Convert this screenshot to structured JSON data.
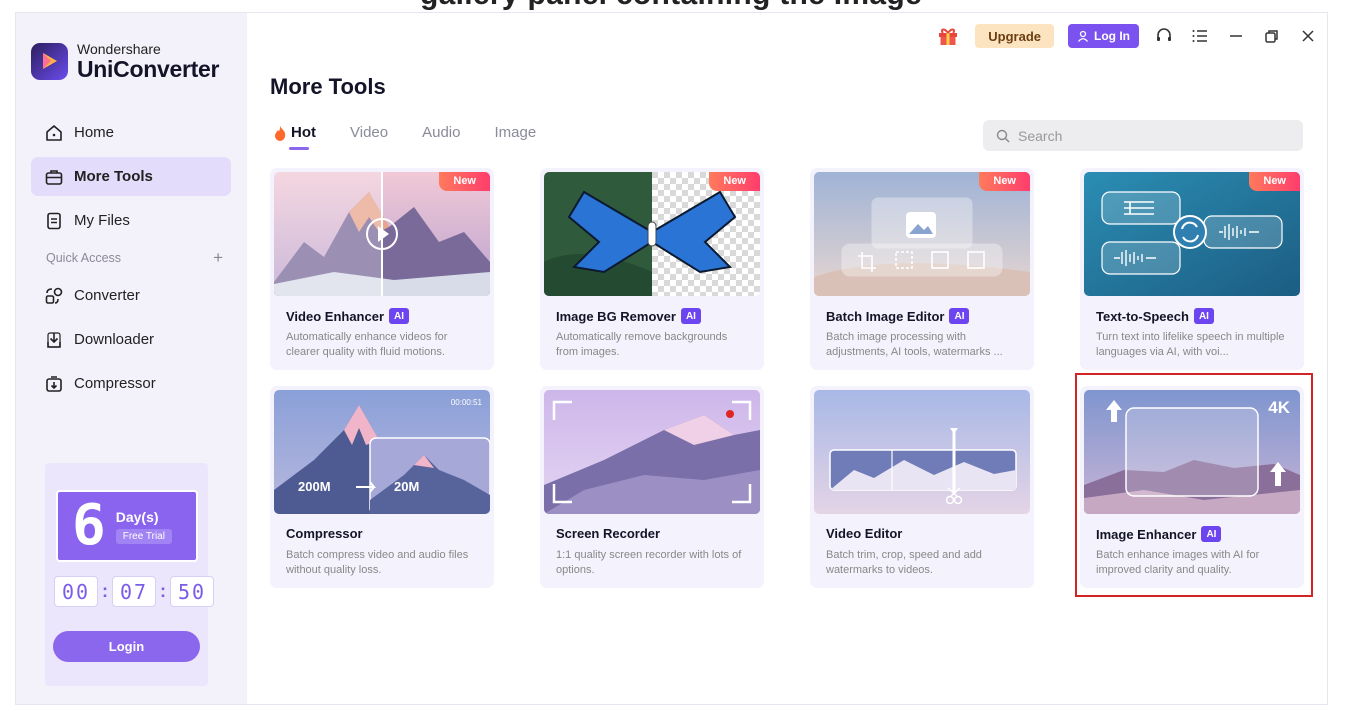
{
  "caption": "gallery panel containing the Image",
  "brand": {
    "line1": "Wondershare",
    "line2": "UniConverter"
  },
  "sidebar": {
    "items": [
      {
        "label": "Home",
        "icon": "home-icon"
      },
      {
        "label": "More Tools",
        "icon": "toolbox-icon"
      },
      {
        "label": "My Files",
        "icon": "file-icon"
      }
    ],
    "quick_access": "Quick Access",
    "quick_items": [
      {
        "label": "Converter",
        "icon": "converter-icon"
      },
      {
        "label": "Downloader",
        "icon": "downloader-icon"
      },
      {
        "label": "Compressor",
        "icon": "compressor-icon"
      }
    ]
  },
  "trial": {
    "days": "6",
    "days_label": "Day(s)",
    "badge": "Free Trial",
    "hh": "00",
    "mm": "07",
    "ss": "50",
    "login": "Login"
  },
  "titlebar": {
    "upgrade": "Upgrade",
    "login": "Log In"
  },
  "main": {
    "title": "More Tools",
    "tabs": [
      "Hot",
      "Video",
      "Audio",
      "Image"
    ],
    "search_placeholder": "Search"
  },
  "cards": [
    {
      "title": "Video Enhancer",
      "desc": "Automatically enhance videos for clearer quality with fluid motions.",
      "badge": "New"
    },
    {
      "title": "Image BG Remover",
      "desc": "Automatically remove backgrounds from images.",
      "badge": "New"
    },
    {
      "title": "Batch Image Editor",
      "desc": "Batch image processing with adjustments, AI tools, watermarks ...",
      "badge": "New"
    },
    {
      "title": "Text-to-Speech",
      "desc": "Turn text into lifelike speech in multiple languages via AI, with voi...",
      "badge": "New"
    },
    {
      "title": "Compressor",
      "desc": "Batch compress video and audio files without quality loss.",
      "thumb_from": "200M",
      "thumb_to": "20M",
      "thumb_time": "00:00:51"
    },
    {
      "title": "Screen Recorder",
      "desc": "1:1 quality screen recorder with lots of options."
    },
    {
      "title": "Video Editor",
      "desc": "Batch trim, crop, speed and add watermarks to videos."
    },
    {
      "title": "Image Enhancer",
      "desc": "Batch enhance images with AI for improved clarity and quality.",
      "thumb_res": "4K"
    }
  ],
  "ai_label": "AI",
  "colors": {
    "accent": "#7b52ef",
    "new_badge": "#ff4d6a",
    "highlight": "#d32424"
  }
}
